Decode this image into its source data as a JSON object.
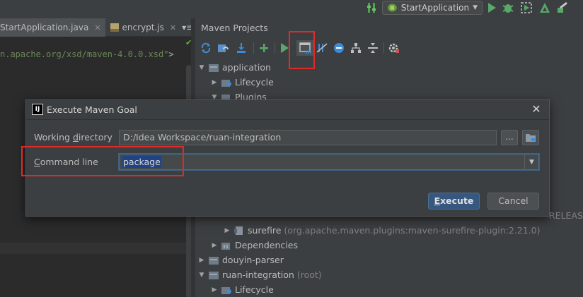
{
  "run_toolbar": {
    "config_name": "StartApplication",
    "icons": [
      "vcs-update-icon",
      "run-config-icon",
      "run-icon",
      "debug-icon",
      "coverage-icon",
      "profile-icon",
      "build-icon"
    ]
  },
  "editor": {
    "tabs": [
      {
        "label": "StartApplication.java"
      },
      {
        "label": "encrypt.js"
      }
    ],
    "tab_overflow": "▾≡3",
    "code_prefix": "n.apache.org/xsd/maven-4.0.0.xsd",
    "code_suffix": ">"
  },
  "maven": {
    "title": "Maven Projects",
    "tree": [
      {
        "label": "application",
        "expanded": true
      },
      {
        "label": "Lifecycle",
        "expanded": false
      },
      {
        "label": "Plugins",
        "expanded": true
      },
      {
        "label": "RELEASE",
        "note": ""
      },
      {
        "label": "surefire",
        "note": "(org.apache.maven.plugins:maven-surefire-plugin:2.21.0)"
      },
      {
        "label": "Dependencies",
        "expanded": false
      },
      {
        "label": "douyin-parser",
        "expanded": false
      },
      {
        "label": "ruan-integration",
        "note": "(root)",
        "expanded": true
      },
      {
        "label": "Lifecycle",
        "expanded": false
      }
    ]
  },
  "dialog": {
    "title": "Execute Maven Goal",
    "working_directory_label_pre": "Working ",
    "working_directory_label_mnemonic": "d",
    "working_directory_label_post": "irectory",
    "working_directory_value": "D:/Idea Workspace/ruan-integration",
    "browse_label": "...",
    "command_line_label_mnemonic": "C",
    "command_line_label_post": "ommand line",
    "command_line_value": "package",
    "execute_label_mnemonic": "E",
    "execute_label_post": "xecute",
    "cancel_label": "Cancel"
  },
  "colors": {
    "highlight_box": "#e02a2a",
    "primary_button": "#365880",
    "selection": "#214283"
  }
}
